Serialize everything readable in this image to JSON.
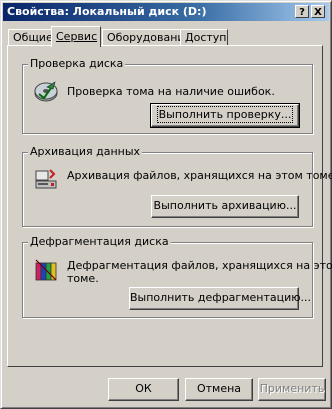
{
  "window": {
    "title": "Свойства: Локальный диск (D:)",
    "help_button": "?",
    "close_button": "X"
  },
  "tabs": [
    {
      "label": "Общие",
      "active": false
    },
    {
      "label": "Сервис",
      "active": true
    },
    {
      "label": "Оборудование",
      "active": false
    },
    {
      "label": "Доступ",
      "active": false
    }
  ],
  "groups": {
    "check": {
      "title": "Проверка диска",
      "description": "Проверка тома на наличие ошибок.",
      "button": "Выполнить проверку...",
      "icon": "disk-check-icon"
    },
    "backup": {
      "title": "Архивация данных",
      "description": "Архивация файлов, хранящихся на этом томе.",
      "button": "Выполнить архивацию...",
      "icon": "backup-icon"
    },
    "defrag": {
      "title": "Дефрагментация диска",
      "description_line1": "Дефрагментация файлов, хранящихся на этом",
      "description_line2": "томе.",
      "button": "Выполнить дефрагментацию...",
      "icon": "defrag-icon"
    }
  },
  "footer": {
    "ok": "ОК",
    "cancel": "Отмена",
    "apply": "Применить",
    "apply_enabled": false
  },
  "colors": {
    "titlebar_start": "#0a246a",
    "titlebar_end": "#a6caf0",
    "face": "#d4d0c8"
  }
}
